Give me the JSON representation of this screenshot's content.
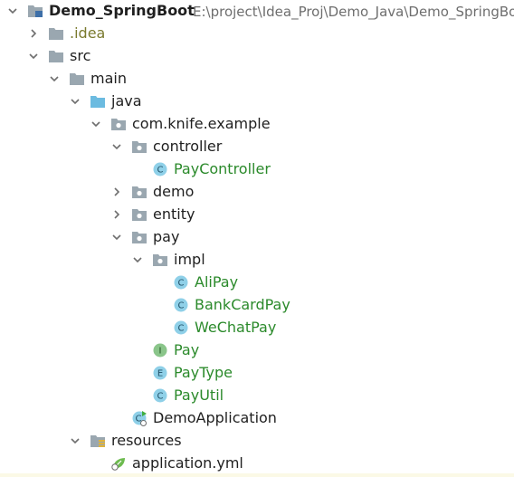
{
  "project": {
    "name": "Demo_SpringBoot",
    "path": "E:\\project\\Idea_Proj\\Demo_Java\\Demo_SpringBoot"
  },
  "tree": {
    "idea": ".idea",
    "src": "src",
    "main": "main",
    "java": "java",
    "package": "com.knife.example",
    "controller": "controller",
    "pay_controller": "PayController",
    "demo": "demo",
    "entity": "entity",
    "pay": "pay",
    "impl": "impl",
    "ali_pay": "AliPay",
    "bank_card_pay": "BankCardPay",
    "wechat_pay": "WeChatPay",
    "pay_interface": "Pay",
    "pay_type": "PayType",
    "pay_util": "PayUtil",
    "demo_application": "DemoApplication",
    "resources": "resources",
    "application_yml": "application.yml"
  },
  "icons": {
    "class_letter": "C",
    "interface_letter": "I",
    "enum_letter": "E"
  },
  "colors": {
    "folder": "#9aa7b0",
    "source_folder": "#6cbbe0",
    "class_badge": "#8fd0e8",
    "interface_badge": "#8ac58a",
    "green_text": "#2b8a2b",
    "idea_text": "#7a7a2e"
  }
}
